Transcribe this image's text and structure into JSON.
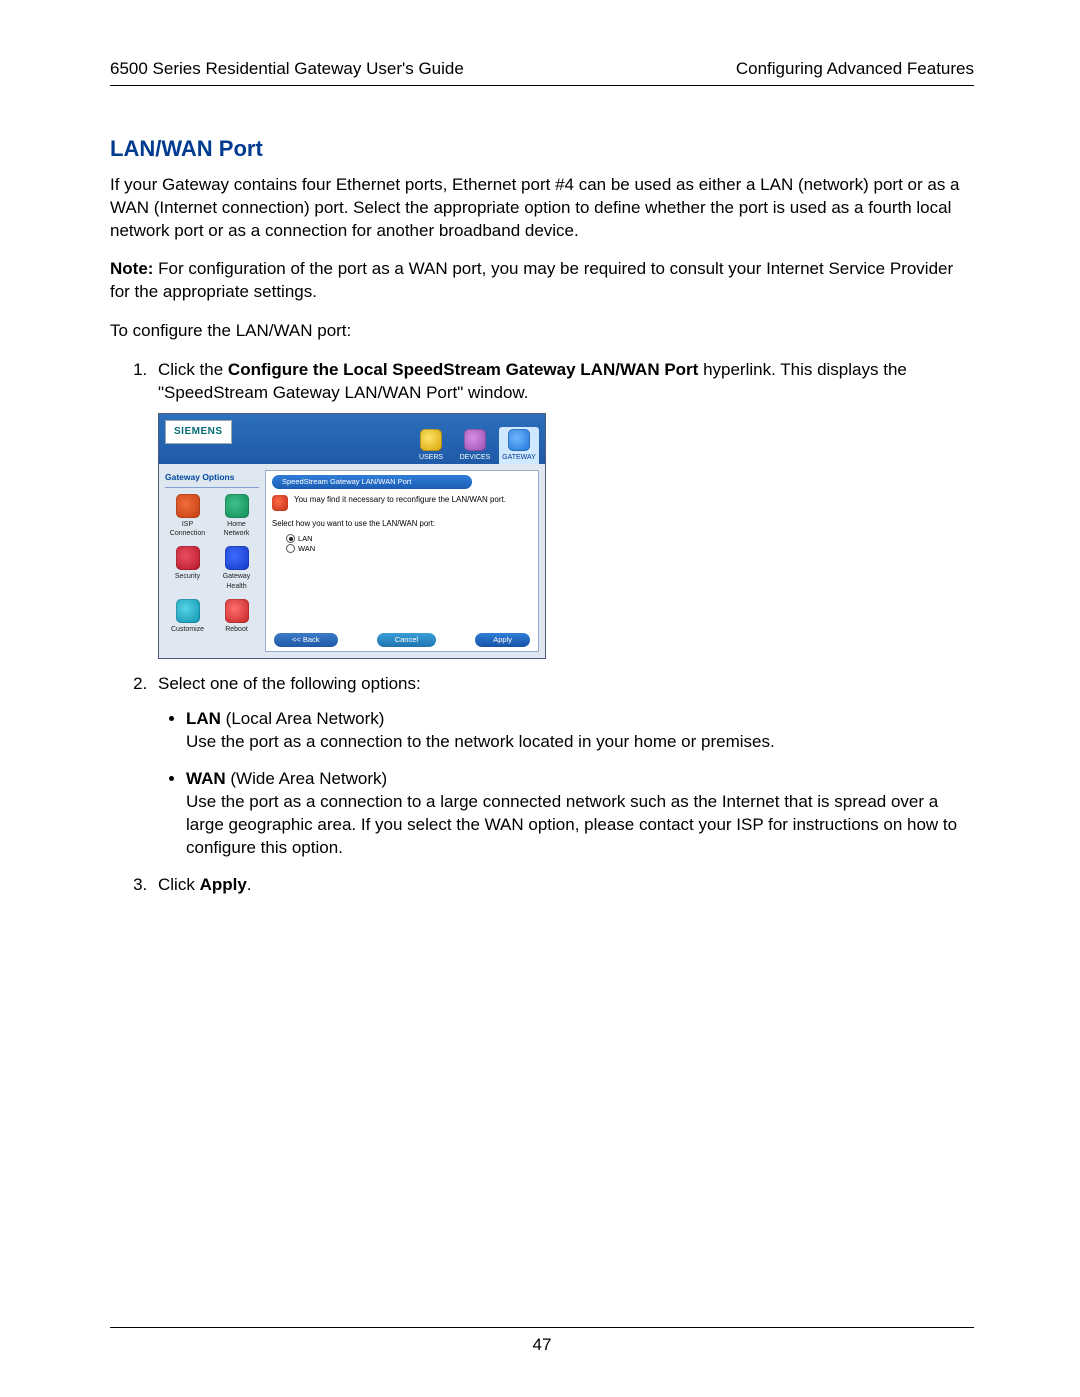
{
  "header": {
    "left": "6500 Series Residential Gateway User's Guide",
    "right": "Configuring Advanced Features"
  },
  "heading": "LAN/WAN Port",
  "intro": "If your Gateway contains four Ethernet ports, Ethernet port #4 can be used as either a LAN (network) port or as a WAN (Internet connection) port. Select the appropriate option to define whether the port is used as a fourth local network port or as a connection for another broadband device.",
  "note_label": "Note:",
  "note_body": " For configuration of the port as a WAN port, you may be required to consult your Internet Service Provider for the appropriate settings.",
  "to_configure": "To configure the LAN/WAN port:",
  "step1_pre": "Click the ",
  "step1_bold": "Configure the Local SpeedStream Gateway LAN/WAN Port",
  "step1_post": " hyperlink. This displays the \"SpeedStream Gateway LAN/WAN Port\" window.",
  "screenshot": {
    "logo": "SIEMENS",
    "tabs": {
      "users": "USERS",
      "devices": "DEVICES",
      "gateway": "GATEWAY"
    },
    "sidebar_header": "Gateway Options",
    "sidebar": {
      "isp": "ISP Connection",
      "home": "Home Network",
      "security": "Security",
      "health": "Gateway Health",
      "customize": "Customize",
      "reboot": "Reboot"
    },
    "panel_title": "SpeedStream Gateway LAN/WAN Port",
    "info_text": "You may find it necessary to reconfigure the LAN/WAN port.",
    "select_how": "Select how you want to use the LAN/WAN port:",
    "radio_lan": "LAN",
    "radio_wan": "WAN",
    "buttons": {
      "back": "<< Back",
      "cancel": "Cancel",
      "apply": "Apply"
    }
  },
  "step2_intro": "Select one of the following options:",
  "lan_bold": "LAN",
  "lan_paren": " (Local Area Network)",
  "lan_body": "Use the port as a connection  to the network located in your home or premises.",
  "wan_bold": "WAN",
  "wan_paren": " (Wide Area Network)",
  "wan_body": "Use the port as a connection to a large connected network such as the Internet that is spread over a large geographic area. If you select the WAN option, please contact your ISP for instructions on how to configure this option.",
  "step3_pre": "Click ",
  "step3_bold": "Apply",
  "step3_post": ".",
  "page_number": "47"
}
